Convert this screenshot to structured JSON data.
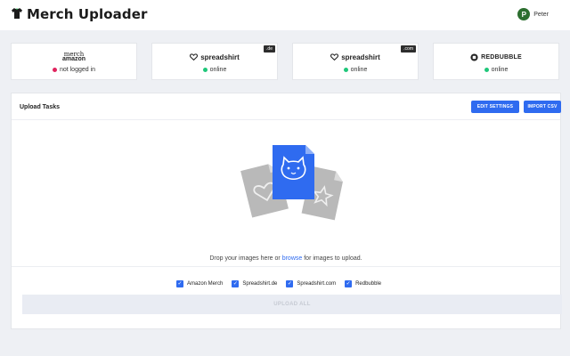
{
  "header": {
    "title": "Merch Uploader",
    "user_initial": "P",
    "user_name": "Peter",
    "logo_icon": "tshirt-icon"
  },
  "platforms": [
    {
      "name": "merch by amazon",
      "logo_line1": "merch",
      "logo_line2": "amazon",
      "status": "not logged in",
      "status_color": "#e0245e",
      "badge": ""
    },
    {
      "name": "spreadshirt",
      "logo_text": "spreadshirt",
      "status": "online",
      "status_color": "#1fc77a",
      "badge": ".de"
    },
    {
      "name": "spreadshirt",
      "logo_text": "spreadshirt",
      "status": "online",
      "status_color": "#1fc77a",
      "badge": ".com"
    },
    {
      "name": "redbubble",
      "logo_text": "REDBUBBLE",
      "status": "online",
      "status_color": "#1fc77a",
      "badge": ""
    }
  ],
  "upload": {
    "title": "Upload Tasks",
    "edit_settings_label": "EDIT SETTINGS",
    "import_csv_label": "IMPORT CSV",
    "drop_text_before": "Drop your images here or ",
    "browse_label": "browse",
    "drop_text_after": " for images to upload.",
    "targets": [
      {
        "label": "Amazon Merch",
        "checked": true
      },
      {
        "label": "Spreadshirt.de",
        "checked": true
      },
      {
        "label": "Spreadshirt.com",
        "checked": true
      },
      {
        "label": "Redbubble",
        "checked": true
      }
    ],
    "upload_all_label": "UPLOAD ALL"
  },
  "colors": {
    "accent": "#2f6bf0",
    "online": "#1fc77a",
    "offline": "#e0245e",
    "background": "#eef0f4"
  }
}
